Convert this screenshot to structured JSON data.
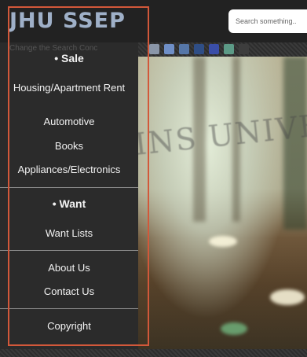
{
  "header": {
    "logo_text": "JHU SSEP",
    "search_placeholder": "Search something.."
  },
  "swatches": [
    "#8a96a8",
    "#6f8fc7",
    "#5677a8",
    "#2f4e86",
    "#3a4ea8",
    "#5c9a86",
    "#3d3d3d"
  ],
  "hero": {
    "carved_text": "INS UNIVERSITY"
  },
  "sidebar": {
    "behind_text": "Change the Search Conc",
    "sale_header": "• Sale",
    "sale_items": [
      "Housing/Apartment Rent",
      "Automotive",
      "Books",
      "Appliances/Electronics"
    ],
    "want_header": "• Want",
    "want_items": [
      "Want Lists"
    ],
    "info_items": [
      "About Us",
      "Contact Us"
    ],
    "footer_items": [
      "Copyright"
    ]
  },
  "colors": {
    "logo": "#9fb0c8",
    "sidebar_bg": "#2b2b2b",
    "highlight": "#d2583a"
  }
}
